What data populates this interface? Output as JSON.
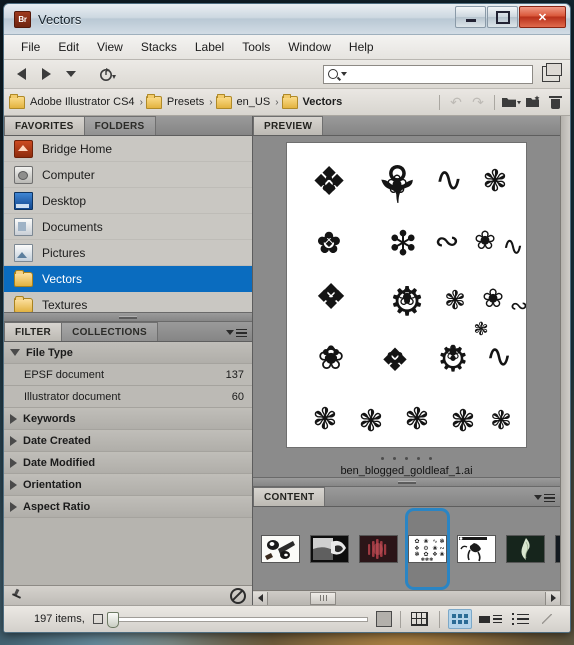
{
  "window": {
    "app_icon_label": "Br",
    "title": "Vectors",
    "controls": {
      "minimize": "minimize-button",
      "maximize": "maximize-button",
      "close": "✕"
    }
  },
  "menubar": {
    "items": [
      "File",
      "Edit",
      "View",
      "Stacks",
      "Label",
      "Tools",
      "Window",
      "Help"
    ]
  },
  "toolbar": {
    "back_icon": "back-arrow-icon",
    "forward_icon": "forward-arrow-icon",
    "dropdown_icon": "chevron-down-icon",
    "recent_icon": "recent-folders-icon",
    "search": {
      "placeholder": "",
      "value": "",
      "icon": "search-icon"
    },
    "switch_workspace_icon": "window-switcher-icon"
  },
  "breadcrumb": {
    "items": [
      "Adobe Illustrator CS4",
      "Presets",
      "en_US",
      "Vectors"
    ],
    "separator": "›",
    "current": "Vectors",
    "actions": {
      "rotate_ccw": "rotate-counterclockwise-icon",
      "rotate_cw": "rotate-clockwise-icon",
      "open_recent": "open-folder-icon",
      "new_folder": "new-folder-icon",
      "delete": "trash-icon"
    }
  },
  "favorites_panel": {
    "tabs": [
      {
        "label": "FAVORITES",
        "active": true
      },
      {
        "label": "FOLDERS",
        "active": false
      }
    ],
    "items": [
      {
        "label": "Bridge Home",
        "icon": "bridge-home-icon",
        "selected": false
      },
      {
        "label": "Computer",
        "icon": "computer-icon",
        "selected": false
      },
      {
        "label": "Desktop",
        "icon": "desktop-icon",
        "selected": false
      },
      {
        "label": "Documents",
        "icon": "documents-icon",
        "selected": false
      },
      {
        "label": "Pictures",
        "icon": "pictures-icon",
        "selected": false
      },
      {
        "label": "Vectors",
        "icon": "folder-icon",
        "selected": true
      },
      {
        "label": "Textures",
        "icon": "folder-icon",
        "selected": false
      }
    ]
  },
  "filter_panel": {
    "tabs": [
      {
        "label": "FILTER",
        "active": true
      },
      {
        "label": "COLLECTIONS",
        "active": false
      }
    ],
    "groups": [
      {
        "label": "File Type",
        "expanded": true,
        "items": [
          {
            "label": "EPSF document",
            "count": "137"
          },
          {
            "label": "Illustrator document",
            "count": "60"
          }
        ]
      },
      {
        "label": "Keywords",
        "expanded": false,
        "items": []
      },
      {
        "label": "Date Created",
        "expanded": false,
        "items": []
      },
      {
        "label": "Date Modified",
        "expanded": false,
        "items": []
      },
      {
        "label": "Orientation",
        "expanded": false,
        "items": []
      },
      {
        "label": "Aspect Ratio",
        "expanded": false,
        "items": []
      }
    ],
    "footer": {
      "pin_icon": "keep-filter-pin-icon",
      "clear_icon": "clear-filter-icon"
    }
  },
  "preview_panel": {
    "tabs": [
      {
        "label": "PREVIEW",
        "active": true
      }
    ],
    "filename": "ben_blogged_goldleaf_1.ai",
    "page_dots": 5
  },
  "content_panel": {
    "tabs": [
      {
        "label": "CONTENT",
        "active": true
      }
    ],
    "thumbnails": [
      {
        "name": "thumbnail-1",
        "selected": false
      },
      {
        "name": "thumbnail-2",
        "selected": false
      },
      {
        "name": "thumbnail-3",
        "selected": false
      },
      {
        "name": "thumbnail-4",
        "selected": true
      },
      {
        "name": "thumbnail-5",
        "selected": false
      },
      {
        "name": "thumbnail-6",
        "selected": false
      },
      {
        "name": "thumbnail-7",
        "selected": false
      }
    ],
    "scroll": {
      "left_arrow": "scroll-left-arrow",
      "right_arrow": "scroll-right-arrow"
    }
  },
  "statusbar": {
    "item_count": "197 items,",
    "small_thumb_icon": "small-thumbnail-icon",
    "large_thumb_icon": "large-thumbnail-icon",
    "zoom_value": 0,
    "view_buttons": [
      {
        "name": "grid-lock-view-button",
        "active": false
      },
      {
        "name": "thumbnail-view-button",
        "active": true
      },
      {
        "name": "details-view-button",
        "active": false
      },
      {
        "name": "list-view-button",
        "active": false
      }
    ]
  },
  "colors": {
    "selection_blue": "#0a6cbf",
    "thumb_highlight_blue": "#2a85c4",
    "panel_gray": "#8b8b8b",
    "close_red": "#b8301a"
  }
}
